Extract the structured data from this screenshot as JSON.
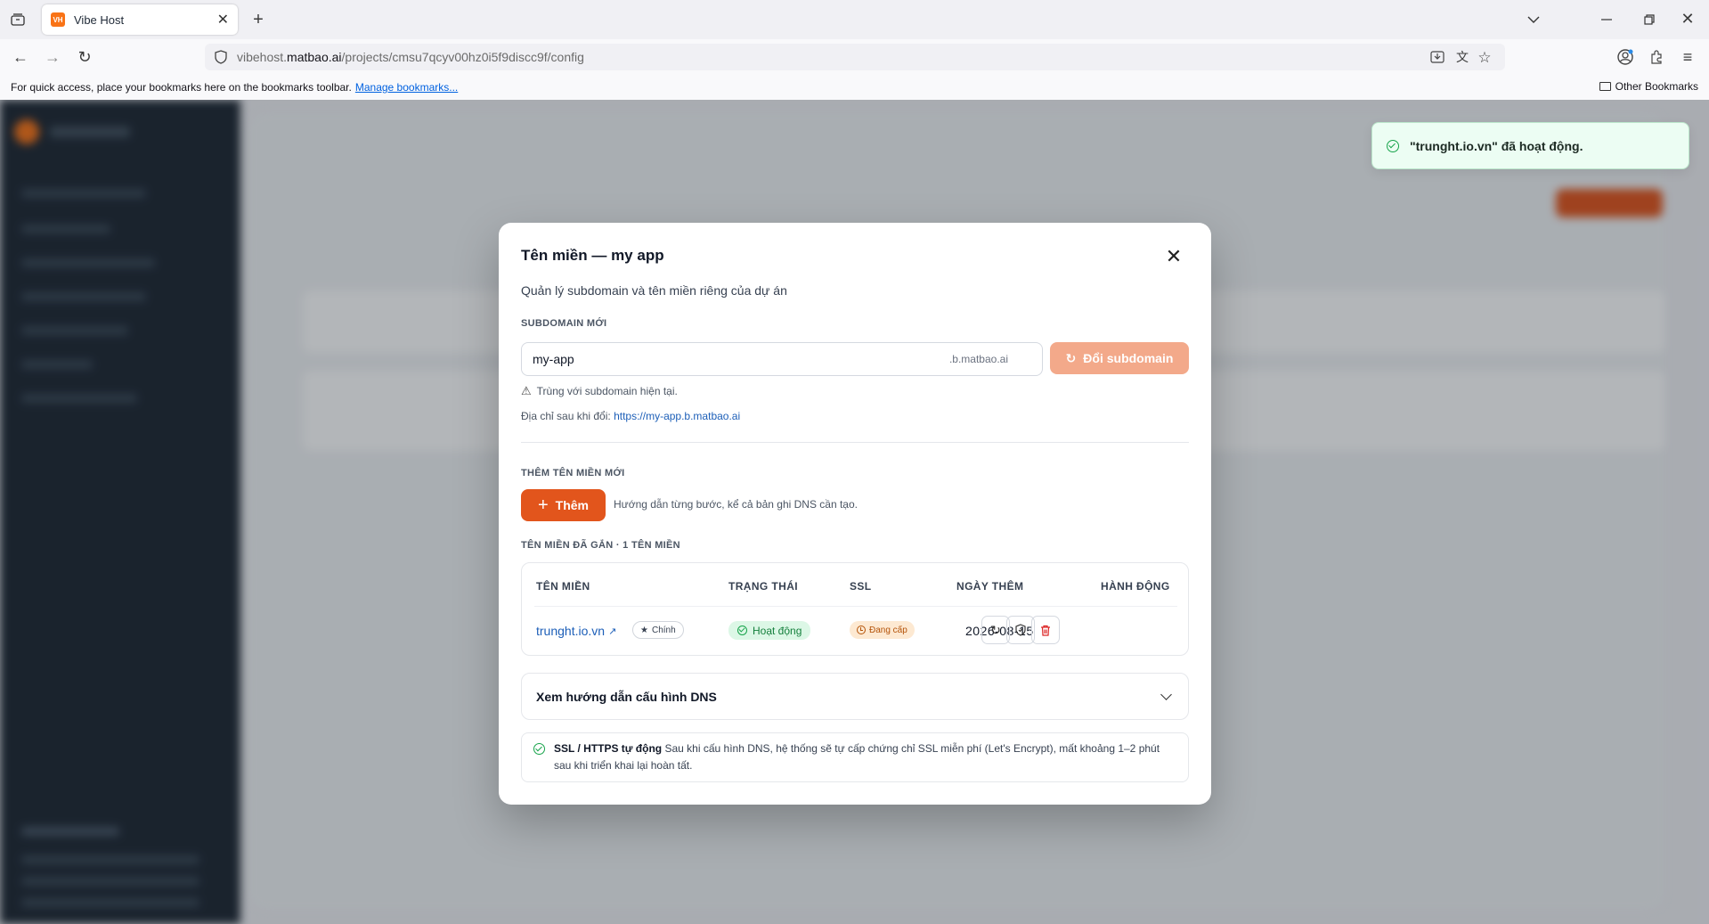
{
  "browser": {
    "tab_title": "Vibe Host",
    "tab_favicon": "VH",
    "url_prefix": "vibehost.",
    "url_host": "matbao.ai",
    "url_path": "/projects/cmsu7qcyv00hz0i5f9discc9f/config",
    "bookmarks_text": "For quick access, place your bookmarks here on the bookmarks toolbar.",
    "bookmarks_link": "Manage bookmarks...",
    "other_bookmarks": "Other Bookmarks"
  },
  "toast": {
    "message": "\"trunght.io.vn\" đã hoạt động."
  },
  "modal": {
    "title": "Tên miền — my app",
    "subtitle": "Quản lý subdomain và tên miền riêng của dự án",
    "subdomain_section": "SUBDOMAIN MỚI",
    "subdomain_value": "my-app",
    "subdomain_suffix": ".b.matbao.ai",
    "change_button": "Đổi subdomain",
    "warning": "Trùng với subdomain hiện tại.",
    "address_label": "Địa chỉ sau khi đổi:",
    "address_url": "https://my-app.b.matbao.ai",
    "add_section": "THÊM TÊN MIỀN MỚI",
    "add_button": "Thêm",
    "add_hint": "Hướng dẫn từng bước, kể cả bản ghi DNS cần tạo.",
    "attached_section": "TÊN MIỀN ĐÃ GẮN · 1 TÊN MIỀN",
    "table": {
      "headers": [
        "TÊN MIỀN",
        "TRẠNG THÁI",
        "SSL",
        "NGÀY THÊM",
        "HÀNH ĐỘNG"
      ],
      "rows": [
        {
          "domain": "trunght.io.vn",
          "tag": "Chính",
          "status": "Hoạt động",
          "ssl": "Đang cấp",
          "date": "2026-08-15"
        }
      ]
    },
    "dns_guide": "Xem hướng dẫn cấu hình DNS",
    "ssl_title": "SSL / HTTPS tự động",
    "ssl_text": "Sau khi cấu hình DNS, hệ thống sẽ tự cấp chứng chỉ SSL miễn phí (Let's Encrypt), mất khoảng 1–2 phút sau khi triển khai lại hoàn tất."
  },
  "colors": {
    "accent": "#e2551c",
    "accent_light": "#f3a98a",
    "success": "#16a34a",
    "link": "#1d5fb8"
  }
}
